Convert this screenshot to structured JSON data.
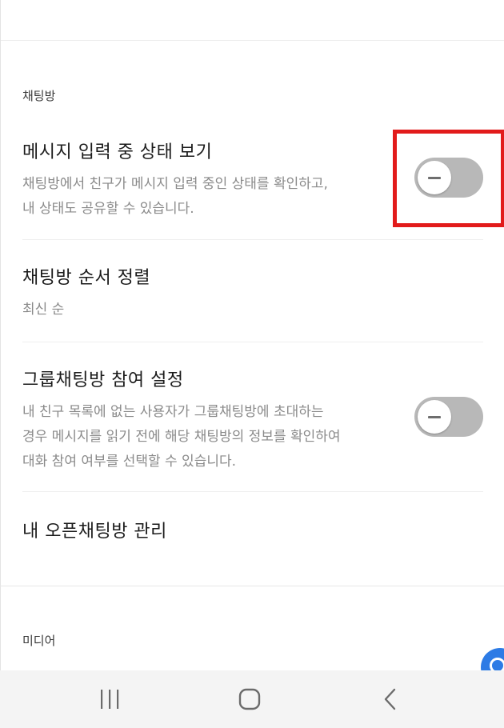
{
  "sections": {
    "chat_room": {
      "header": "채팅방",
      "typing_status": {
        "title": "메시지 입력 중 상태 보기",
        "description_line1": "채팅방에서 친구가 메시지 입력 중인 상태를 확인하고,",
        "description_line2": "내 상태도 공유할 수 있습니다.",
        "toggle_on": false
      },
      "sort_order": {
        "title": "채팅방 순서 정렬",
        "value": "최신 순"
      },
      "group_join": {
        "title": "그룹채팅방 참여 설정",
        "description_line1": "내 친구 목록에 없는 사용자가 그룹채팅방에 초대하는",
        "description_line2": "경우 메시지를 읽기 전에 해당 채팅방의 정보를 확인하여",
        "description_line3": "대화 참여 여부를 선택할 수 있습니다.",
        "toggle_on": false
      },
      "open_chat": {
        "title": "내 오픈채팅방 관리"
      }
    },
    "media": {
      "header": "미디어"
    }
  },
  "colors": {
    "toggle_off": "#b8b8b8",
    "highlight": "#e21b1b",
    "fab": "#2d7be5"
  },
  "navbar": {
    "recent_apps_icon": "recent-apps-icon",
    "home_icon": "home-icon",
    "back_icon": "back-icon"
  }
}
